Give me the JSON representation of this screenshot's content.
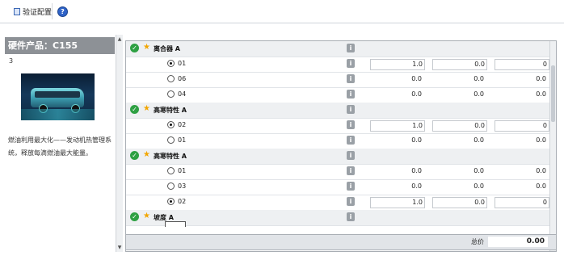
{
  "toolbar": {
    "verify_label": "验证配置",
    "help_label": "?"
  },
  "product": {
    "title": "硬件产品：C155",
    "number": "3",
    "description": "燃油利用最大化——发动机热管理系统，释放每滴燃油最大能量。"
  },
  "rows": [
    {
      "type": "group",
      "label": "离合器 A"
    },
    {
      "type": "option",
      "label": "01",
      "selected": true,
      "v1": "1.0",
      "v2": "0.0",
      "v3": "0",
      "boxed": true
    },
    {
      "type": "option",
      "label": "06",
      "selected": false,
      "v1": "0.0",
      "v2": "0.0",
      "v3": "0.0",
      "boxed": false
    },
    {
      "type": "option",
      "label": "04",
      "selected": false,
      "v1": "0.0",
      "v2": "0.0",
      "v3": "0.0",
      "boxed": false
    },
    {
      "type": "group",
      "label": "高寒特性 A"
    },
    {
      "type": "option",
      "label": "02",
      "selected": true,
      "v1": "1.0",
      "v2": "0.0",
      "v3": "0",
      "boxed": true
    },
    {
      "type": "option",
      "label": "01",
      "selected": false,
      "v1": "0.0",
      "v2": "0.0",
      "v3": "0.0",
      "boxed": false
    },
    {
      "type": "group",
      "label": "高寒特性 A"
    },
    {
      "type": "option",
      "label": "01",
      "selected": false,
      "v1": "0.0",
      "v2": "0.0",
      "v3": "0.0",
      "boxed": false
    },
    {
      "type": "option",
      "label": "03",
      "selected": false,
      "v1": "0.0",
      "v2": "0.0",
      "v3": "0.0",
      "boxed": false
    },
    {
      "type": "option",
      "label": "02",
      "selected": true,
      "v1": "1.0",
      "v2": "0.0",
      "v3": "0",
      "boxed": true
    },
    {
      "type": "group",
      "label": "坡度 A"
    }
  ],
  "footer": {
    "total_label": "总价",
    "total_value": "0.00"
  }
}
